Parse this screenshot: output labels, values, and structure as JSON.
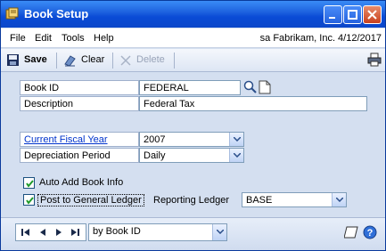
{
  "window": {
    "title": "Book Setup",
    "accent": "#0a4bd6"
  },
  "menubar": {
    "items": [
      "File",
      "Edit",
      "Tools",
      "Help"
    ],
    "context": "sa  Fabrikam, Inc.  4/12/2017"
  },
  "toolbar": {
    "save_label": "Save",
    "clear_label": "Clear",
    "delete_label": "Delete"
  },
  "form": {
    "book_id_label": "Book ID",
    "book_id_value": "FEDERAL",
    "description_label": "Description",
    "description_value": "Federal Tax",
    "fiscal_year_label": "Current Fiscal Year",
    "fiscal_year_value": "2007",
    "depreciation_label": "Depreciation Period",
    "depreciation_value": "Daily",
    "auto_add_label": "Auto Add Book Info",
    "auto_add_checked": true,
    "post_gl_label": "Post to General Ledger",
    "post_gl_checked": true,
    "reporting_ledger_label": "Reporting Ledger",
    "reporting_ledger_value": "BASE"
  },
  "statusbar": {
    "sort_value": "by Book ID"
  },
  "icons": {
    "title": "book-app-icon",
    "save": "disk-icon",
    "clear": "eraser-icon",
    "delete": "delete-icon",
    "print": "printer-icon",
    "lookup": "magnifier-icon",
    "note": "note-icon",
    "help": "help-icon"
  }
}
